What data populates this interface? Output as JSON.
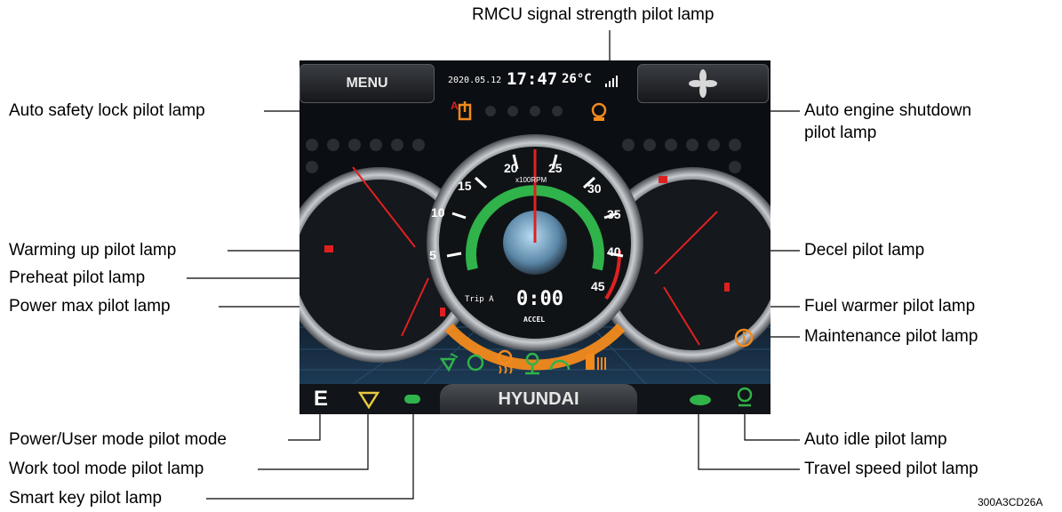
{
  "screen": {
    "menu_label": "MENU",
    "date": "2020.05.12",
    "time": "17:47",
    "temperature": "26°C",
    "rpm_unit": "x100RPM",
    "rpm_ticks": [
      "5",
      "10",
      "15",
      "20",
      "25",
      "30",
      "35",
      "40",
      "45"
    ],
    "trip_label": "Trip A",
    "trip_value": "0:00",
    "accel_label": "ACCEL",
    "brand": "HYUNDAI",
    "power_mode_letter": "E",
    "auto_safety_lock_text": "A"
  },
  "callouts": {
    "rmcu_signal": "RMCU signal strength pilot lamp",
    "auto_safety_lock": "Auto safety lock pilot lamp",
    "auto_engine_shutdown_line1": "Auto engine shutdown",
    "auto_engine_shutdown_line2": "pilot lamp",
    "warming_up": "Warming up pilot lamp",
    "decel": "Decel pilot lamp",
    "preheat": "Preheat pilot lamp",
    "power_max": "Power max pilot lamp",
    "fuel_warmer": "Fuel warmer pilot lamp",
    "maintenance": "Maintenance pilot lamp",
    "power_user_mode": "Power/User mode pilot mode",
    "auto_idle": "Auto idle pilot lamp",
    "work_tool_mode": "Work tool mode pilot lamp",
    "travel_speed": "Travel speed pilot lamp",
    "smart_key": "Smart key pilot lamp"
  },
  "figure_id": "300A3CD26A",
  "colors": {
    "lamp_orange": "#f28a1c",
    "lamp_green": "#2fb34a",
    "needle_red": "#e02020",
    "screen_bg": "#0b0e12"
  }
}
